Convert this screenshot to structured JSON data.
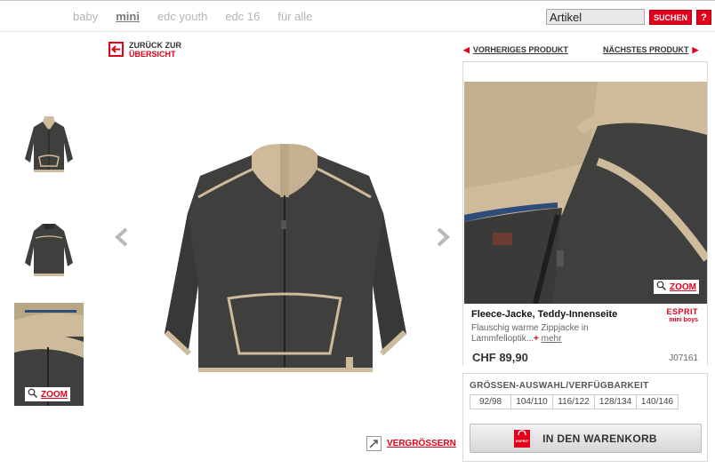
{
  "nav": {
    "tabs": [
      {
        "label": "baby"
      },
      {
        "label": "mini"
      },
      {
        "label": "edc youth"
      },
      {
        "label": "edc 16"
      },
      {
        "label": "für alle"
      }
    ],
    "search_value": "Artikel",
    "search_button": "SUCHEN",
    "help": "?"
  },
  "back": {
    "line1": "ZURÜCK ZUR",
    "line2": "ÜBERSICHT"
  },
  "gallery": {
    "zoom_label": "ZOOM",
    "enlarge_label": "VERGRÖSSERN"
  },
  "product_nav": {
    "prev": "VORHERIGES PRODUKT",
    "next": "NÄCHSTES PRODUKT"
  },
  "product": {
    "title": "Fleece-Jacke, Teddy-Innenseite",
    "description": "Flauschig warme Zippjacke in Lammfelloptik...",
    "more_plus": "+",
    "more": "mehr",
    "price": "CHF 89,90",
    "sku": "J07161",
    "brand_line1": "ESPRIT",
    "brand_line2": "mini boys",
    "zoom_label": "ZOOM"
  },
  "sizes": {
    "heading": "GRÖSSEN-AUSWAHL/VERFÜGBARKEIT",
    "options": [
      "92/98",
      "104/110",
      "116/122",
      "128/134",
      "140/146"
    ],
    "cart_label": "IN DEN WARENKORB",
    "cart_icon_text": "ESPRIT"
  },
  "colors": {
    "accent": "#e2001a",
    "jacket": "#3f403e",
    "fleece": "#cdbb9c"
  }
}
